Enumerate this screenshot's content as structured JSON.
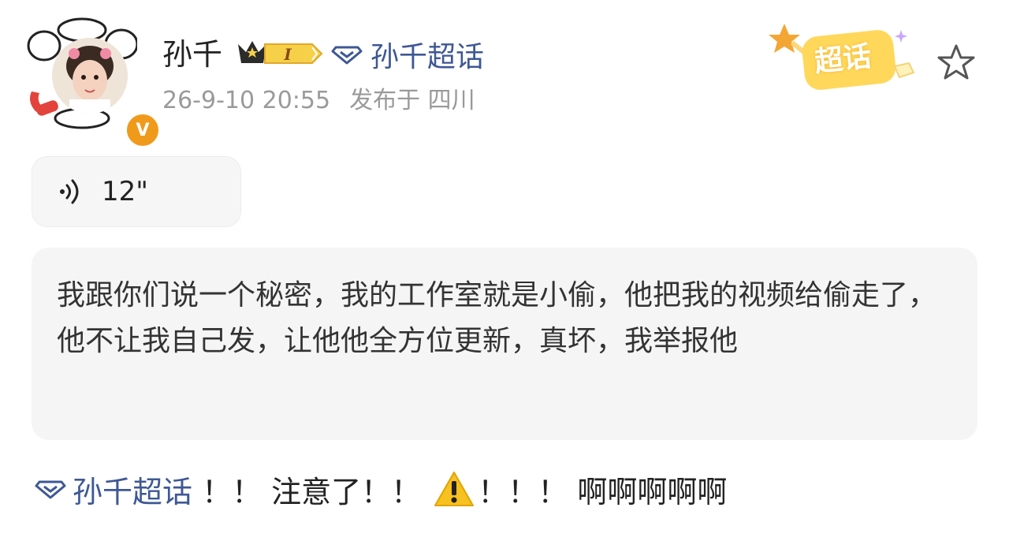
{
  "post": {
    "username": "孙千",
    "supertopic_link": "孙千超话",
    "timestamp": "26-9-10 20:55",
    "location": "发布于 四川",
    "badge_level": "I",
    "chaohua_badge": "超话",
    "voice": {
      "duration": "12\""
    },
    "quote_text": "我跟你们说一个秘密，我的工作室就是小偷，他把我的视频给偷走了，他不让我自己发，让他他全方位更新，真坏，我举报他",
    "footer": {
      "topic": "孙千超话",
      "text1": " ！！ 注意了！！ ",
      "text2": "！！！ 啊啊啊啊啊"
    }
  },
  "colors": {
    "link": "#3e5894",
    "meta": "#9a9a9a",
    "verified": "#f09a1c",
    "badge": "#f7d04a"
  },
  "icons": [
    "verified-icon",
    "crown-badge-icon",
    "diamond-topic-icon",
    "chaohua-badge-icon",
    "star-icon",
    "voice-icon",
    "warning-icon"
  ]
}
